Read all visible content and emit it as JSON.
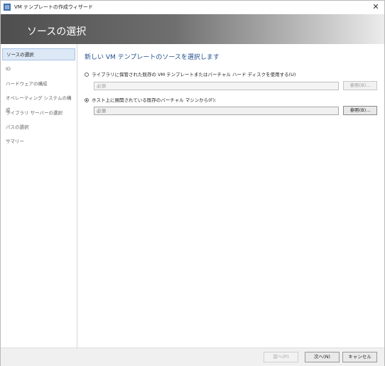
{
  "window": {
    "title": "VM テンプレートの作成ウィザード",
    "app_icon": "server-icon",
    "close_glyph": "✕"
  },
  "banner": {
    "title": "ソースの選択"
  },
  "sidebar": {
    "items": [
      {
        "label": "ソースの選択",
        "active": true
      },
      {
        "label": "ID",
        "active": false
      },
      {
        "label": "ハードウェアの構成",
        "active": false
      },
      {
        "label": "オペレーティング システムの構成",
        "active": false
      },
      {
        "label": "ライブラリ サーバーの選択",
        "active": false
      },
      {
        "label": "パスの選択",
        "active": false
      },
      {
        "label": "サマリー",
        "active": false
      }
    ]
  },
  "main": {
    "heading": "新しい VM テンプレートのソースを選択します",
    "option1": {
      "label": "ライブラリに保管された既存の VM テンプレートまたはバーチャル ハード ディスクを使用する(U)",
      "selected": false,
      "field_placeholder": "必須",
      "browse_label": "参照(B)..."
    },
    "option2": {
      "label": "ホスト上に展開されている既存のバーチャル マシンから(F):",
      "selected": true,
      "field_placeholder": "必須",
      "browse_label": "参照(B)..."
    }
  },
  "footer": {
    "prev_label": "前へ(P)",
    "next_label": "次へ(N)",
    "cancel_label": "キャンセル"
  }
}
